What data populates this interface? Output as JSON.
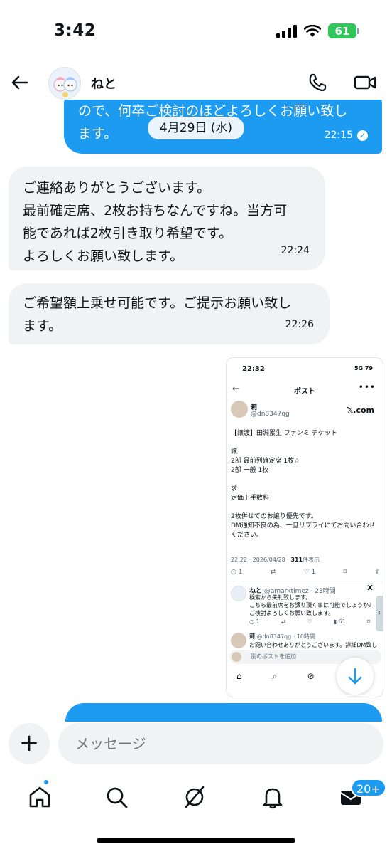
{
  "status": {
    "time": "3:42",
    "battery": "61"
  },
  "header": {
    "contact_name": "ねと"
  },
  "messages": [
    {
      "direction": "out",
      "text_lines": [
        "ので、何卒ご検討のほどよろしくお願い致し",
        "ます。"
      ],
      "time": "22:15",
      "read": true
    },
    {
      "direction": "in",
      "text_lines": [
        "ご連絡ありがとうございます。",
        "最前確定席、2枚お持ちなんですね。当方可",
        "能であれば2枚引き取り希望です。",
        "よろしくお願い致します。"
      ],
      "time": "22:24"
    },
    {
      "direction": "in",
      "text_lines": [
        "ご希望額上乗せ可能です。ご提示お願い致し",
        "ます。"
      ],
      "time": "22:26"
    }
  ],
  "date_separator": "4月29日 (水)",
  "screenshot": {
    "status_time": "22:32",
    "status_right": "5G 79",
    "title": "ポスト",
    "author_name": "莉",
    "author_handle": "@dn8347qg",
    "xcom": "𝕏.com",
    "body": "【譲渡】田淵累生 ファンミ チケット\n\n譲\n2部 最前列確定席 1枚☆\n2部 一般 1枚\n\n求\n定価＋手数料\n\n2枚併せてのお譲り優先です。\nDM通知不良の為、一旦リプライにてお問い合わせください。",
    "meta_time": "22:22 · 2026/04/28 · ",
    "meta_views": "311",
    "meta_views_label": "件表示",
    "actions": [
      "○ 1",
      "⇄",
      "♡ 1",
      "⌑",
      "⇪"
    ],
    "reply": {
      "name": "ねと",
      "handle": "@amarktimez · 23時間",
      "x": "X",
      "text": "検索から失礼致します。\nこちら最前席をお譲り頂く事は可能でしょうか？\nご検討よろしくお願い致します。",
      "actions": [
        "○ 1",
        "⇄",
        "♡",
        "▮ 61",
        "⌑"
      ]
    },
    "reply2": {
      "name": "莉",
      "handle": "@dn8347qg · 10時間",
      "text": "お問い合わせありがとうございます。詳細DM致し"
    },
    "compose_placeholder": "別のポストを追加"
  },
  "composer": {
    "placeholder": "メッセージ"
  },
  "tabbar": {
    "messages_badge": "20+"
  },
  "colors": {
    "accent": "#1d9bf0",
    "incoming_bg": "#eff3f4",
    "battery": "#30c85a"
  }
}
